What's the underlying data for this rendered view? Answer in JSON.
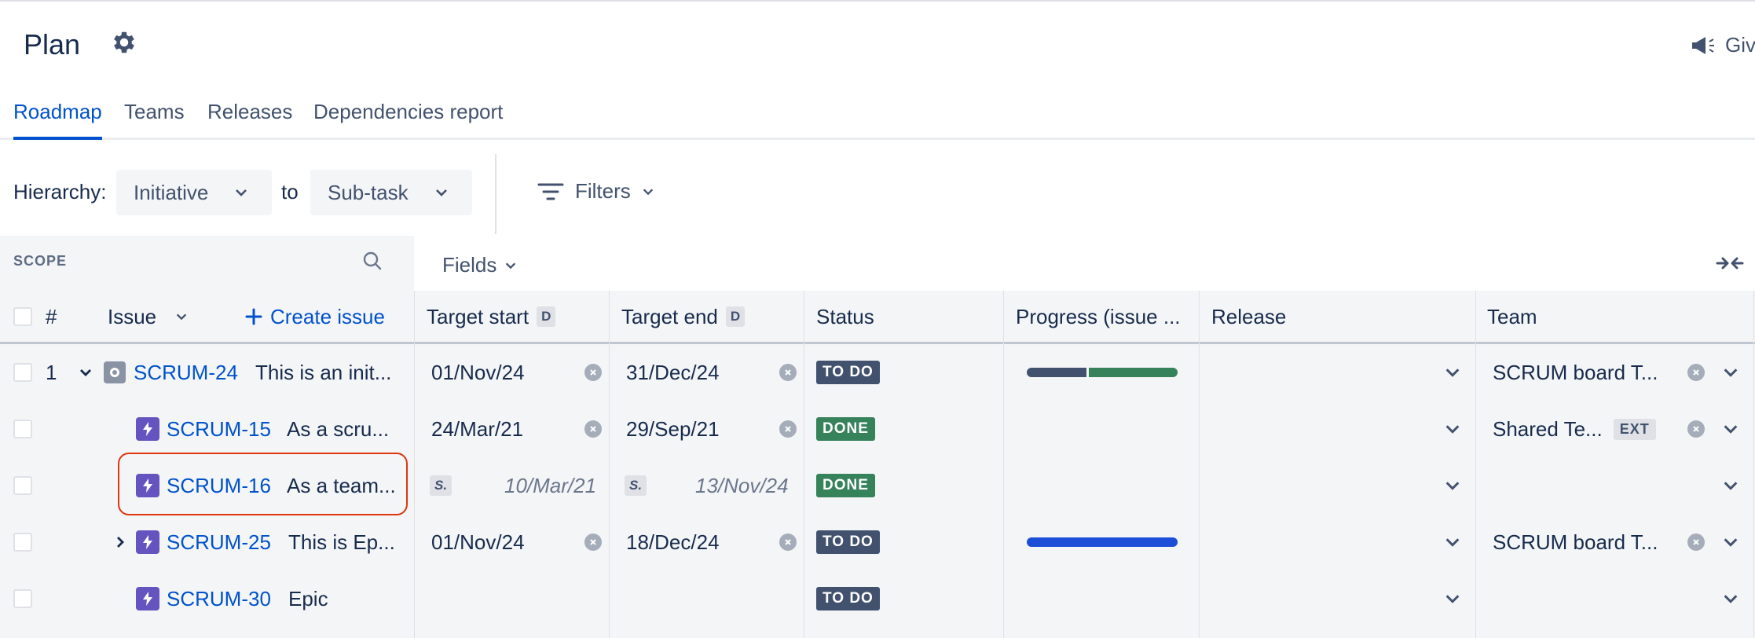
{
  "header": {
    "title": "Plan",
    "feedback_label": "Giv"
  },
  "tabs": [
    {
      "label": "Roadmap",
      "active": true
    },
    {
      "label": "Teams",
      "active": false
    },
    {
      "label": "Releases",
      "active": false
    },
    {
      "label": "Dependencies report",
      "active": false
    }
  ],
  "toolbar": {
    "hierarchy_label": "Hierarchy:",
    "hierarchy_from": "Initiative",
    "to_label": "to",
    "hierarchy_to": "Sub-task",
    "filters_label": "Filters"
  },
  "scope": {
    "label": "SCOPE"
  },
  "fields_label": "Fields",
  "columns": {
    "number": "#",
    "issue": "Issue",
    "create_issue": "Create issue",
    "target_start": "Target start",
    "target_start_badge": "D",
    "target_end": "Target end",
    "target_end_badge": "D",
    "status": "Status",
    "progress": "Progress (issue ...",
    "release": "Release",
    "team": "Team"
  },
  "rows": [
    {
      "num": "1",
      "key": "SCRUM-24",
      "summary": "This is an init...",
      "type": "initiative",
      "start": "01/Nov/24",
      "end": "31/Dec/24",
      "status": "TO DO",
      "team": "SCRUM board T..."
    },
    {
      "num": "",
      "key": "SCRUM-15",
      "summary": "As a scru...",
      "type": "epic",
      "start": "24/Mar/21",
      "end": "29/Sep/21",
      "status": "DONE",
      "team": "Shared Te...",
      "team_badge": "EXT"
    },
    {
      "num": "",
      "key": "SCRUM-16",
      "summary": "As a team...",
      "type": "epic",
      "start_badge": "S.",
      "start": "10/Mar/21",
      "end_badge": "S.",
      "end": "13/Nov/24",
      "status": "DONE",
      "team": ""
    },
    {
      "num": "",
      "key": "SCRUM-25",
      "summary": "This is Ep...",
      "type": "epic",
      "start": "01/Nov/24",
      "end": "18/Dec/24",
      "status": "TO DO",
      "team": "SCRUM board T..."
    },
    {
      "num": "",
      "key": "SCRUM-30",
      "summary": "Epic",
      "type": "epic",
      "start": "",
      "end": "",
      "status": "TO DO",
      "team": ""
    }
  ],
  "progress": [
    {
      "row": 0,
      "done_fraction": 0.4,
      "todo_fraction": 0.6
    },
    {
      "row": 3,
      "in_progress_fraction": 1.0
    }
  ],
  "colors": {
    "accent": "#0052cc",
    "todo": "#42526e",
    "done": "#36825b",
    "epic": "#6554c0",
    "highlight": "#de350b"
  },
  "icons": [
    "settings-gear-icon",
    "megaphone-icon",
    "filter-icon",
    "search-icon",
    "collapse-arrows-icon",
    "plus-icon",
    "chevron-down-icon",
    "chevron-right-icon",
    "initiative-icon",
    "epic-lightning-icon",
    "clear-icon"
  ]
}
